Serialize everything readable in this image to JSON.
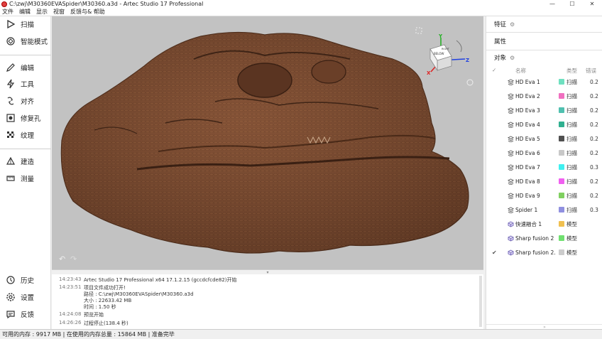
{
  "window": {
    "title": "C:\\zwj\\M30360EVASpider\\M30360.a3d - Artec Studio 17 Professional",
    "controls": {
      "minimize": "—",
      "maximize": "☐",
      "close": "✕"
    }
  },
  "menu": [
    "文件",
    "编辑",
    "显示",
    "视窗",
    "反馈与& 帮助"
  ],
  "tools": {
    "scan": "扫描",
    "smart_mode": "智能模式",
    "edit": "编辑",
    "tools": "工具",
    "align": "对齐",
    "fix_holes": "修复孔",
    "texture": "纹理",
    "build": "建造",
    "measure": "测量",
    "history": "历史",
    "settings": "设置",
    "feedback": "反馈"
  },
  "viewport": {
    "gizmo": {
      "x": "X",
      "y": "Y",
      "z": "Z",
      "cube_front": "BELOW",
      "cube_top": "RIGHT"
    },
    "undo": "↶",
    "redo": "↷",
    "accent_colors": {
      "x": "#e02020",
      "y": "#20b020",
      "z": "#2040e0"
    }
  },
  "log": {
    "entries": [
      {
        "time": "14:23:43",
        "message": "Artec Studio 17 Professional x64 17.1.2.15 (gccdcfcde82)开始"
      },
      {
        "time": "14:23:51",
        "message": "项目文件成功打开!"
      },
      {
        "time": "",
        "message": "路径 : C:\\zwj\\M30360EVASpider\\M30360.a3d"
      },
      {
        "time": "",
        "message": "大小 : 22633.42 MB"
      },
      {
        "time": "",
        "message": "时间 : 1.50 秒"
      },
      {
        "time": "14:24:08",
        "message": "预览开始"
      },
      {
        "time": "14:26:26",
        "message": "过程停止(138.4 秒)"
      }
    ]
  },
  "panel": {
    "features": "特征",
    "properties": "属性",
    "objects": "对象",
    "columns": {
      "name": "名称",
      "type": "类型",
      "error": "错误"
    },
    "objects_list": [
      {
        "name": "HD Eva 1",
        "color": "#6fe0c0",
        "type": "扫描",
        "error": "0.2",
        "checked": false,
        "icon": "scan-icon"
      },
      {
        "name": "HD Eva 2",
        "color": "#f070c0",
        "type": "扫描",
        "error": "0.2",
        "checked": false,
        "icon": "scan-icon"
      },
      {
        "name": "HD Eva 3",
        "color": "#50c0b0",
        "type": "扫描",
        "error": "0.2",
        "checked": false,
        "icon": "scan-icon"
      },
      {
        "name": "HD Eva 4",
        "color": "#30b090",
        "type": "扫描",
        "error": "0.2",
        "checked": false,
        "icon": "scan-icon"
      },
      {
        "name": "HD Eva 5",
        "color": "#505050",
        "type": "扫描",
        "error": "0.2",
        "checked": false,
        "icon": "scan-icon"
      },
      {
        "name": "HD Eva 6",
        "color": "#c8c8c8",
        "type": "扫描",
        "error": "0.2",
        "checked": false,
        "icon": "scan-icon"
      },
      {
        "name": "HD Eva 7",
        "color": "#40f0f0",
        "type": "扫描",
        "error": "0.3",
        "checked": false,
        "icon": "scan-icon"
      },
      {
        "name": "HD Eva 8",
        "color": "#f060f0",
        "type": "扫描",
        "error": "0.2",
        "checked": false,
        "icon": "scan-icon"
      },
      {
        "name": "HD Eva 9",
        "color": "#80d060",
        "type": "扫描",
        "error": "0.2",
        "checked": false,
        "icon": "scan-icon"
      },
      {
        "name": "Spider 1",
        "color": "#9090e0",
        "type": "扫描",
        "error": "0.3",
        "checked": false,
        "icon": "scan-icon"
      },
      {
        "name": "快速融合 1",
        "color": "#f0c050",
        "type": "模型",
        "error": "",
        "checked": false,
        "icon": "model-icon"
      },
      {
        "name": "Sharp fusion 2",
        "color": "#70e070",
        "type": "模型",
        "error": "",
        "checked": false,
        "icon": "model-icon"
      },
      {
        "name": "Sharp fusion 2...",
        "color": "#cccccc",
        "type": "模型",
        "error": "",
        "checked": true,
        "icon": "model-icon"
      }
    ]
  },
  "status": {
    "available_memory_label": "可用的内存 :",
    "available_memory_value": "9917 MB",
    "used_memory_label": "| 在使用的内存总量 :",
    "used_memory_value": "15864 MB",
    "state": "| 准备完毕"
  }
}
